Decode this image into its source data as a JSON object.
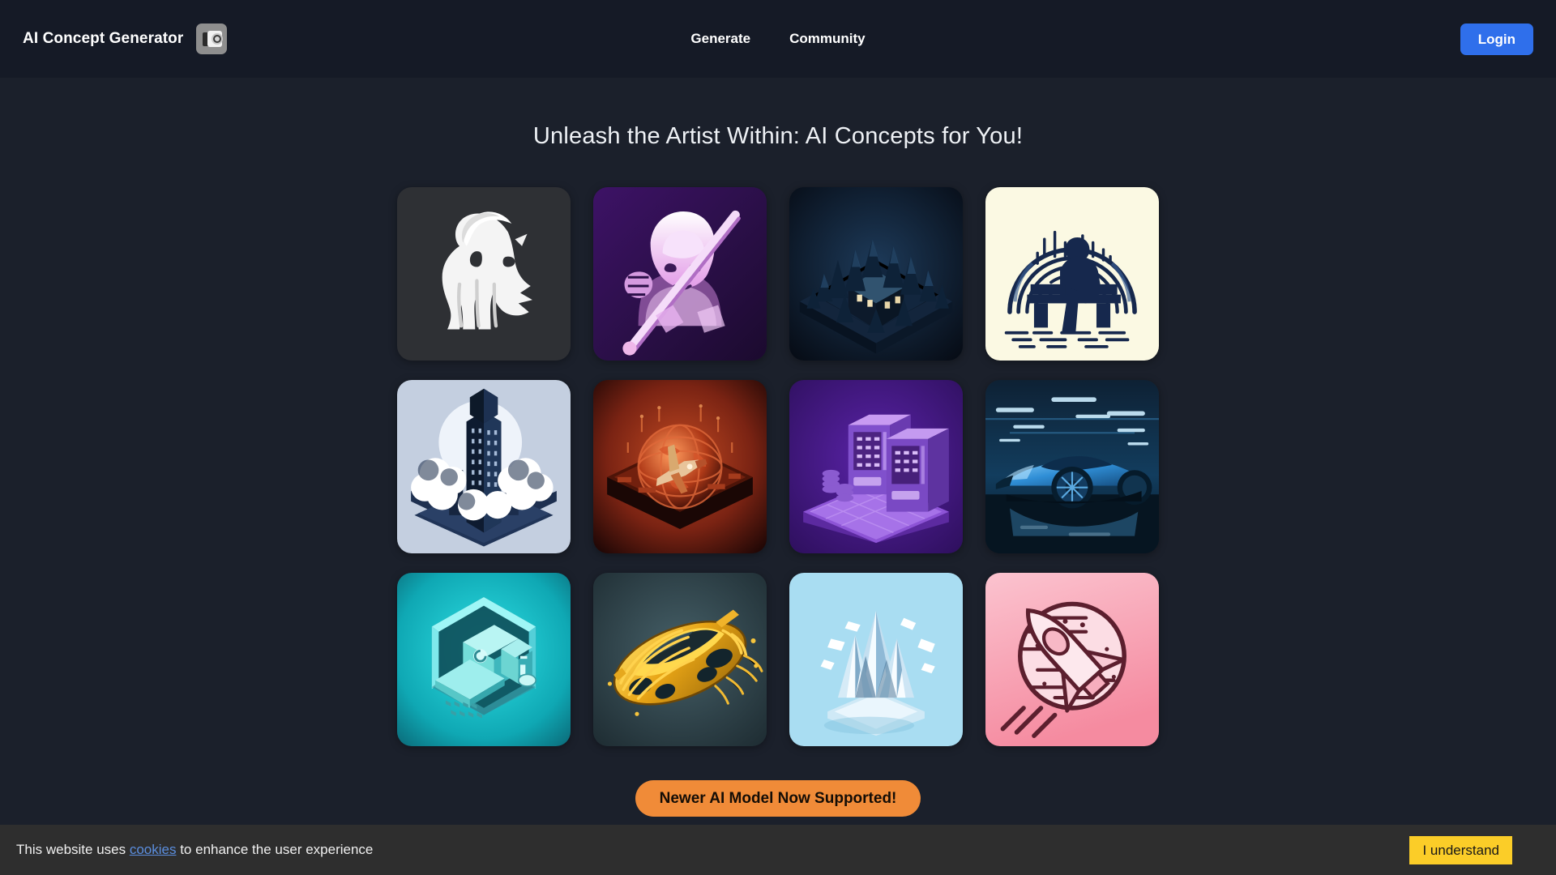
{
  "header": {
    "brand_title": "AI Concept Generator",
    "logo_icon": "camera-icon",
    "nav": [
      {
        "label": "Generate",
        "name": "nav-link-generate"
      },
      {
        "label": "Community",
        "name": "nav-link-community"
      }
    ],
    "login_label": "Login",
    "accent_color": "#2f6feb",
    "background_color": "#151a26"
  },
  "main": {
    "page_title": "Unleash the Artist Within: AI Concepts for You!",
    "background_color": "#1b202b",
    "gallery": {
      "columns": 4,
      "rows": 3,
      "items": [
        {
          "name": "concept-tile-goat-logo",
          "alt": "White goat head mascot logo on dark charcoal background",
          "bg": "#2d2f33"
        },
        {
          "name": "concept-tile-anime-samurai",
          "alt": "Purple anime samurai character holding a katana",
          "bg": "#4b1d78"
        },
        {
          "name": "concept-tile-forest-cabin",
          "alt": "Isometric dark blue pine forest cabin diorama",
          "bg": "#101b2b"
        },
        {
          "name": "concept-tile-line-art-figure",
          "alt": "Navy circular line art of a seated figure on cream",
          "bg": "#fbf9e3"
        },
        {
          "name": "concept-tile-cloud-skyscraper",
          "alt": "Isometric skyscraper rising above clouds",
          "bg": "#c2cddf"
        },
        {
          "name": "concept-tile-red-globe-plane",
          "alt": "Red glowing isometric globe with fighter jet",
          "bg": "#6b1f12"
        },
        {
          "name": "concept-tile-purple-vending",
          "alt": "Purple isometric vending machines on a tiled platform",
          "bg": "#4a1f8c"
        },
        {
          "name": "concept-tile-blue-supercar",
          "alt": "Blue supercar in a neon lit garage",
          "bg": "#0d2236"
        },
        {
          "name": "concept-tile-cyan-computer",
          "alt": "Cyan isometric desktop computer in a hexagon",
          "bg": "#17c4c9"
        },
        {
          "name": "concept-tile-golden-car",
          "alt": "Golden streamlined sports car seen from above",
          "bg": "#35484d"
        },
        {
          "name": "concept-tile-ice-mountain",
          "alt": "Ice crystal mountains on a light blue base",
          "bg": "#a9ddf2"
        },
        {
          "name": "concept-tile-pink-rocket",
          "alt": "Pink rocket crossing a circular planet outline",
          "bg": "#f6a7b5"
        }
      ]
    },
    "announcement_badge": {
      "label": "Newer AI Model Now Supported!",
      "background_color": "#f08b38",
      "text_color": "#140d06"
    }
  },
  "cookie_banner": {
    "text_before": "This website uses ",
    "link_label": "cookies",
    "text_after": " to enhance the user experience",
    "accept_label": "I understand",
    "accept_color": "#fbcd28",
    "background_color": "#2e2e2e"
  }
}
